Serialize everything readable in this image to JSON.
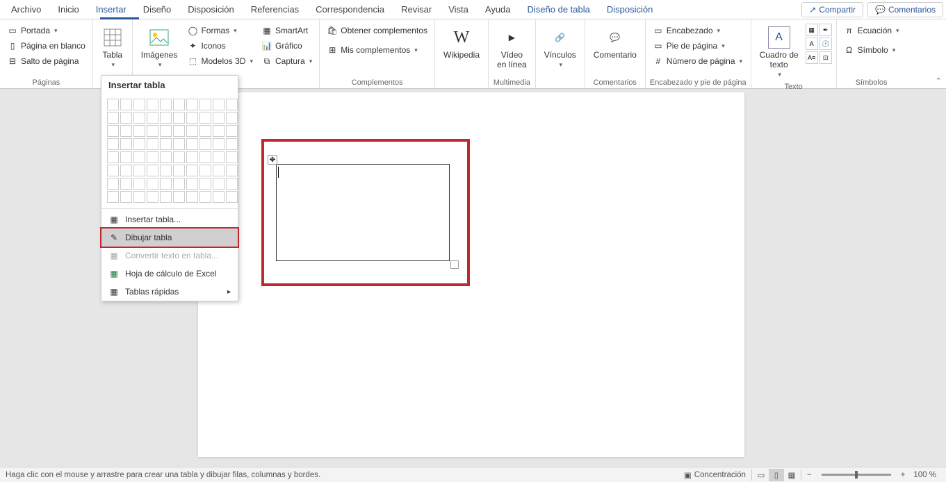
{
  "menubar": {
    "items": [
      "Archivo",
      "Inicio",
      "Insertar",
      "Diseño",
      "Disposición",
      "Referencias",
      "Correspondencia",
      "Revisar",
      "Vista",
      "Ayuda",
      "Diseño de tabla",
      "Disposición"
    ],
    "active_index": 2,
    "contextual_from_index": 10,
    "share": "Compartir",
    "comments": "Comentarios"
  },
  "ribbon": {
    "groups": {
      "paginas": {
        "label": "Páginas",
        "portada": "Portada",
        "blanco": "Página en blanco",
        "salto": "Salto de página"
      },
      "tablas": {
        "label": "",
        "tabla": "Tabla"
      },
      "ilustraciones": {
        "label": "nes",
        "imagenes": "Imágenes",
        "formas": "Formas",
        "iconos": "Iconos",
        "modelos": "Modelos 3D",
        "smartart": "SmartArt",
        "grafico": "Gráfico",
        "captura": "Captura"
      },
      "complementos": {
        "label": "Complementos",
        "obtener": "Obtener complementos",
        "mis": "Mis complementos"
      },
      "wikipedia": {
        "label": "",
        "wikipedia": "Wikipedia"
      },
      "multimedia": {
        "label": "Multimedia",
        "video": "Vídeo\nen línea"
      },
      "vinculos": {
        "label": "",
        "vinculos": "Vínculos"
      },
      "comentarios": {
        "label": "Comentarios",
        "comentario": "Comentario"
      },
      "encabezado": {
        "label": "Encabezado y pie de página",
        "enc": "Encabezado",
        "pie": "Pie de página",
        "num": "Número de página"
      },
      "texto": {
        "label": "Texto",
        "cuadro": "Cuadro de\ntexto"
      },
      "simbolos": {
        "label": "Símbolos",
        "ecuacion": "Ecuación",
        "simbolo": "Símbolo"
      }
    }
  },
  "dropdown": {
    "title": "Insertar tabla",
    "insertar": "Insertar tabla...",
    "dibujar": "Dibujar tabla",
    "convertir": "Convertir texto en tabla...",
    "excel": "Hoja de cálculo de Excel",
    "rapidas": "Tablas rápidas"
  },
  "statusbar": {
    "hint": "Haga clic con el mouse y arrastre para crear una tabla y dibujar filas, columnas y bordes.",
    "concentracion": "Concentración",
    "zoom": "100 %"
  }
}
